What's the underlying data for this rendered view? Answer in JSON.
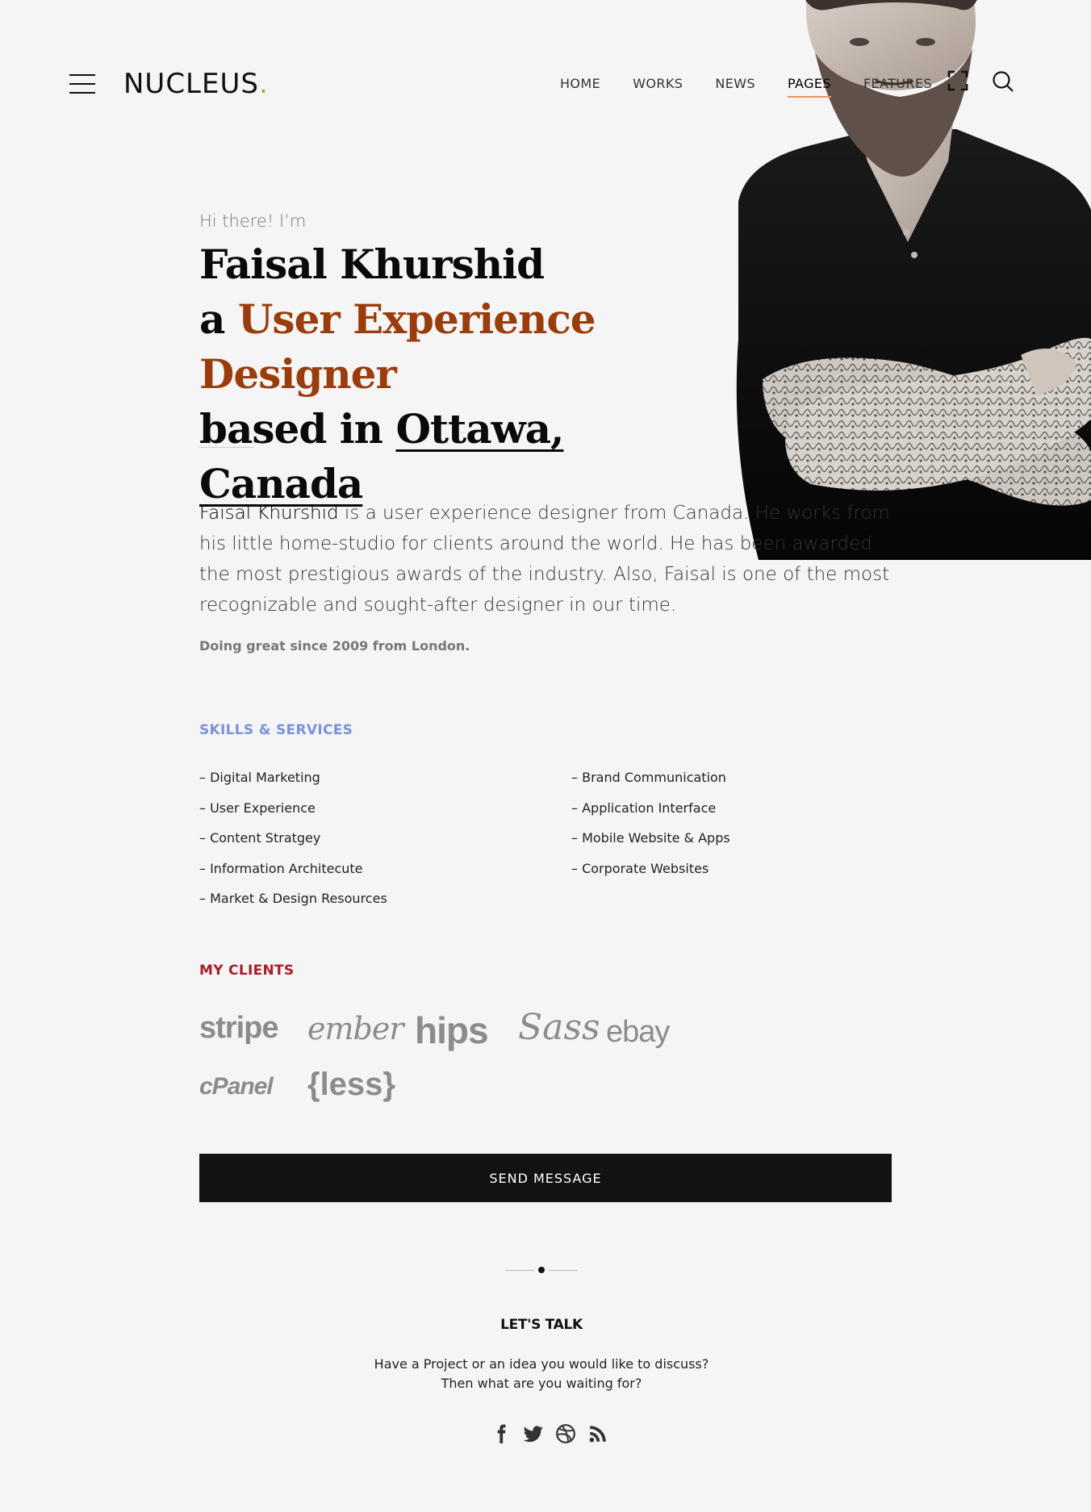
{
  "header": {
    "logo_text": "NUCLEUS",
    "logo_dot": ".",
    "nav": [
      "HOME",
      "WORKS",
      "NEWS",
      "PAGES",
      "FEATURES"
    ],
    "active_nav": "PAGES"
  },
  "hero": {
    "greeting": "Hi there! I’m",
    "name": "Faisal Khurshid",
    "line2_prefix": "a ",
    "role": "User Experience Designer",
    "line3_prefix": "based in ",
    "location": "Ottawa, Canada"
  },
  "bio": {
    "name": "Faisal Khurshid",
    "text": " is a user experience designer from Canada. He works from his little home-studio for clients around the world. He has been awarded the most prestigious awards of the industry. Also, Faisal is one of the most recognizable and sought-after designer in our time.",
    "since": "Doing great since 2009 from London."
  },
  "skills": {
    "title": "SKILLS & SERVICES",
    "left": [
      "– Digital Marketing",
      "– User Experience",
      "– Content Stratgey",
      "– Information Architecute",
      "– Market & Design Resources"
    ],
    "right": [
      "– Brand Communication",
      "– Application Interface",
      "– Mobile Website & Apps",
      "– Corporate Websites"
    ]
  },
  "clients": {
    "title": "MY CLIENTS",
    "logos": [
      "stripe",
      "ember",
      "hips",
      "Sass",
      "ebay",
      "cPanel",
      "{less}"
    ]
  },
  "cta": {
    "send_label": "SEND MESSAGE"
  },
  "talk": {
    "title": "LET'S TALK",
    "line1": "Have a Project or an idea you would like to discuss?",
    "line2": "Then what are you waiting for?"
  },
  "socials": [
    "facebook-icon",
    "twitter-icon",
    "dribbble-icon",
    "rss-icon"
  ],
  "colors": {
    "background": "#f5f5f5",
    "accent_role": "#9a3d0c",
    "skills_title": "#7b93d6",
    "clients_title": "#a81c2a",
    "logo_dot": "#8ab92d",
    "nav_underline": "#e8955e",
    "button": "#121212"
  }
}
